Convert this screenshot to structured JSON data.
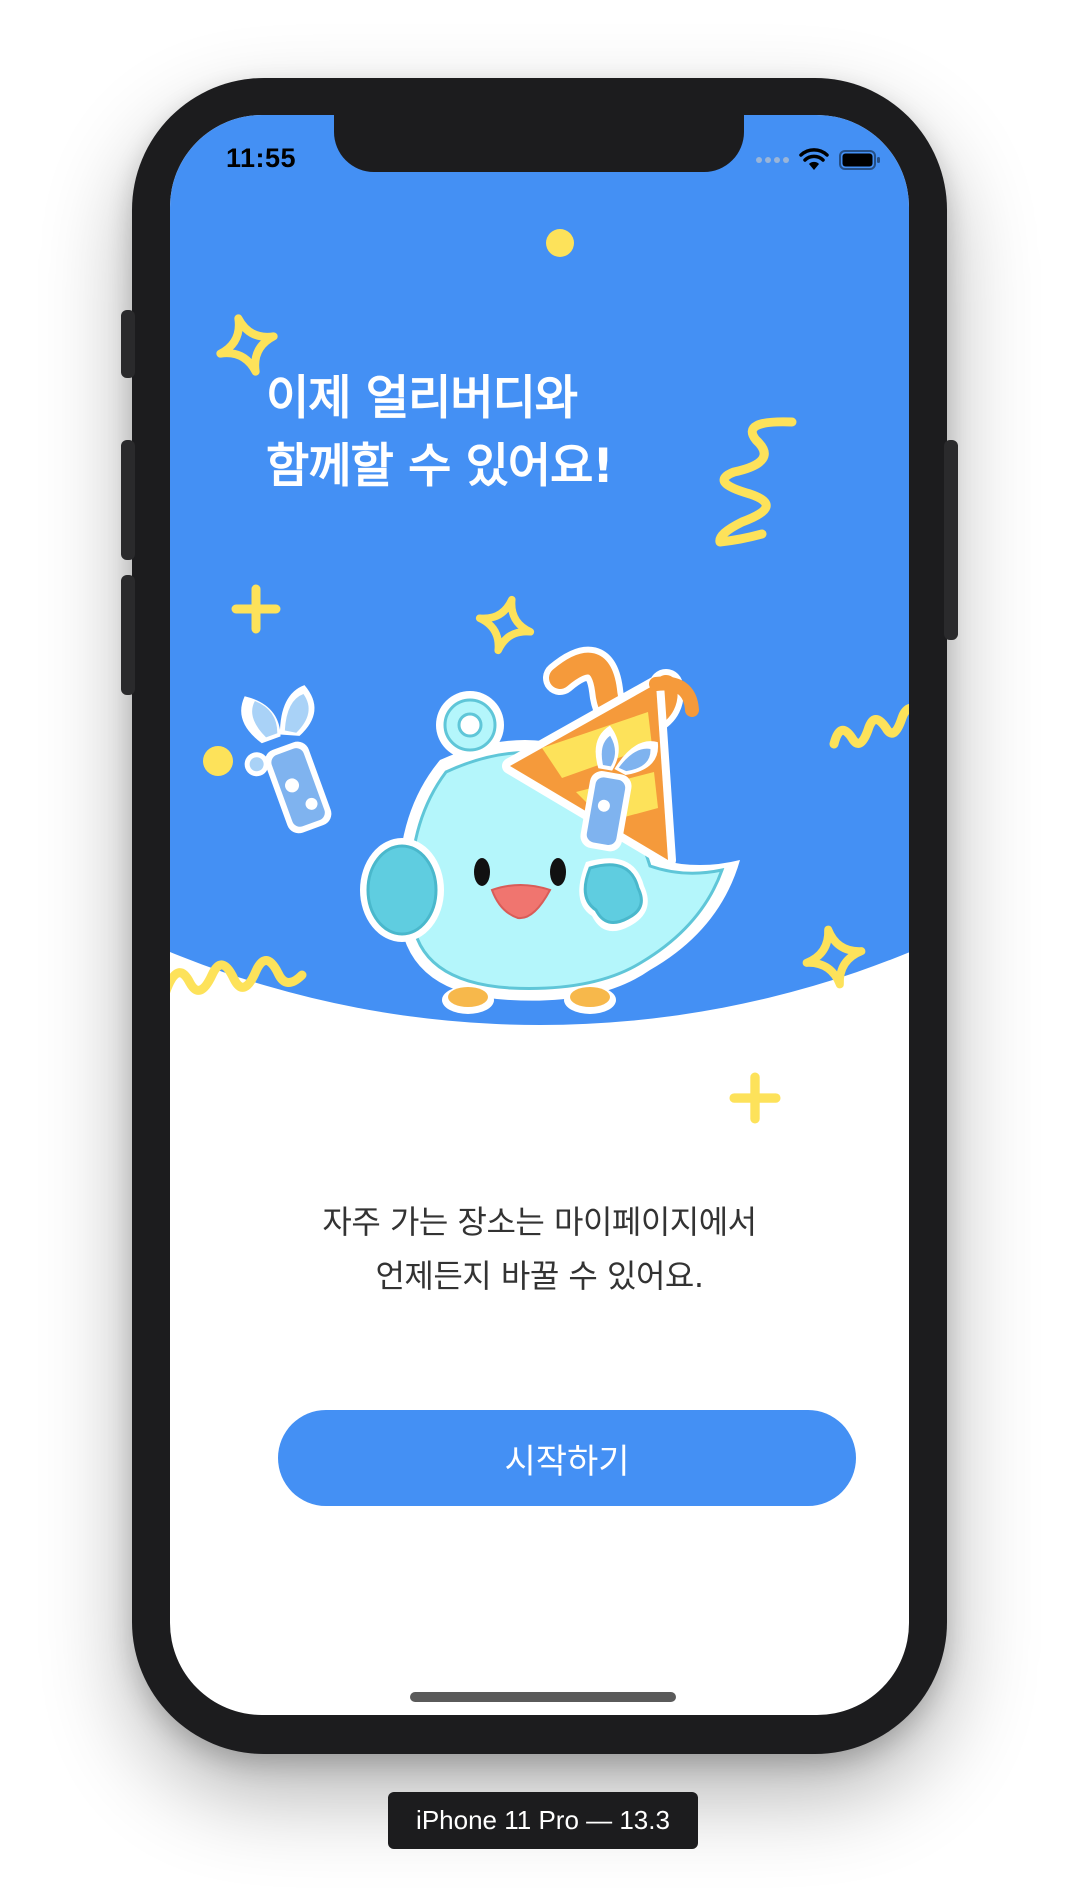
{
  "status_bar": {
    "time": "11:55",
    "icons": [
      "signal-dots-icon",
      "wifi-icon",
      "battery-icon"
    ]
  },
  "onboarding": {
    "headline_line1": "이제 얼리버디와",
    "headline_line2": "함께할 수 있어요!",
    "description_line1": "자주 가는 장소는 마이페이지에서",
    "description_line2": "언제든지 바꿀 수 있어요.",
    "start_button_label": "시작하기",
    "illustration": "party-bird-mascot"
  },
  "device_label": "iPhone 11 Pro — 13.3",
  "colors": {
    "primary_blue": "#4490f4",
    "confetti_yellow": "#fde25a",
    "bird_body": "#b4f6fb",
    "hat_orange": "#f59a3b"
  }
}
